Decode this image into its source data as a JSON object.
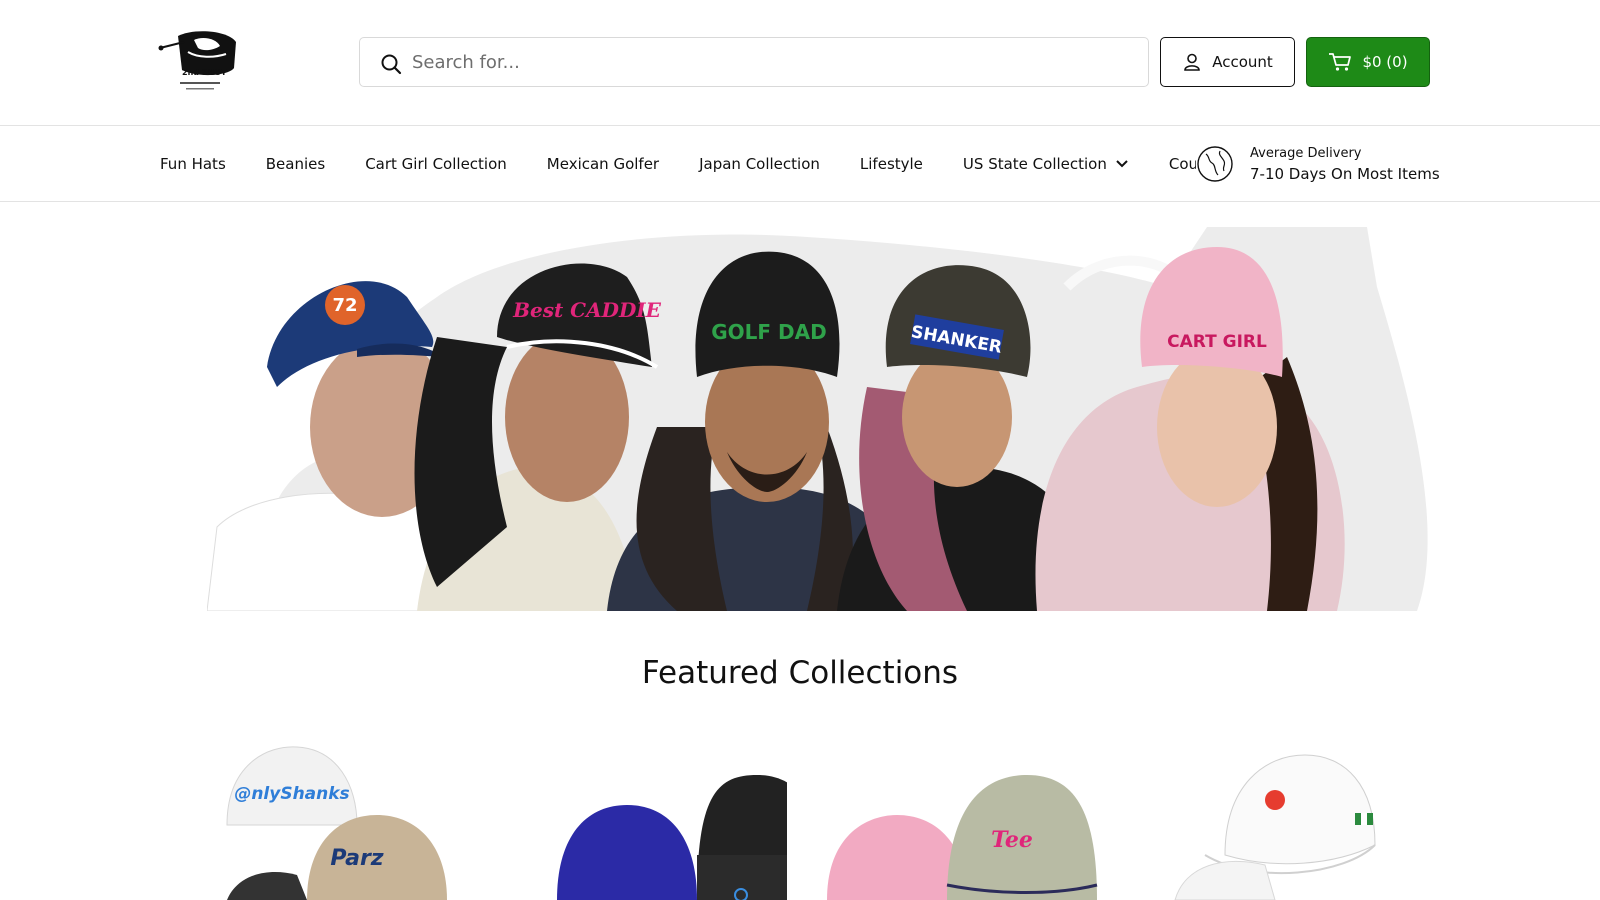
{
  "logo": {
    "text": "2nd SHOT"
  },
  "search": {
    "placeholder": "Search for..."
  },
  "account": {
    "label": "Account"
  },
  "cart": {
    "label": "$0 (0)"
  },
  "nav": {
    "items": [
      "Fun Hats",
      "Beanies",
      "Cart Girl Collection",
      "Mexican Golfer",
      "Japan Collection",
      "Lifestyle",
      "US State Collection",
      "Cou"
    ]
  },
  "delivery": {
    "label": "Average Delivery",
    "value": "7-10 Days On Most Items"
  },
  "hero": {
    "hat_texts": [
      "72",
      "Best CADDIE",
      "GOLF DAD",
      "SHANKER",
      "CART GIRL"
    ]
  },
  "featured": {
    "title": "Featured Collections",
    "collections": [
      {
        "hat_texts": [
          "@nlyShanks",
          "Parz"
        ]
      },
      {
        "hat_texts": []
      },
      {
        "hat_texts": [
          "Tee"
        ]
      },
      {
        "hat_texts": []
      }
    ]
  },
  "colors": {
    "cart_green": "#1e8a17",
    "accent_pink": "#e0257a"
  }
}
